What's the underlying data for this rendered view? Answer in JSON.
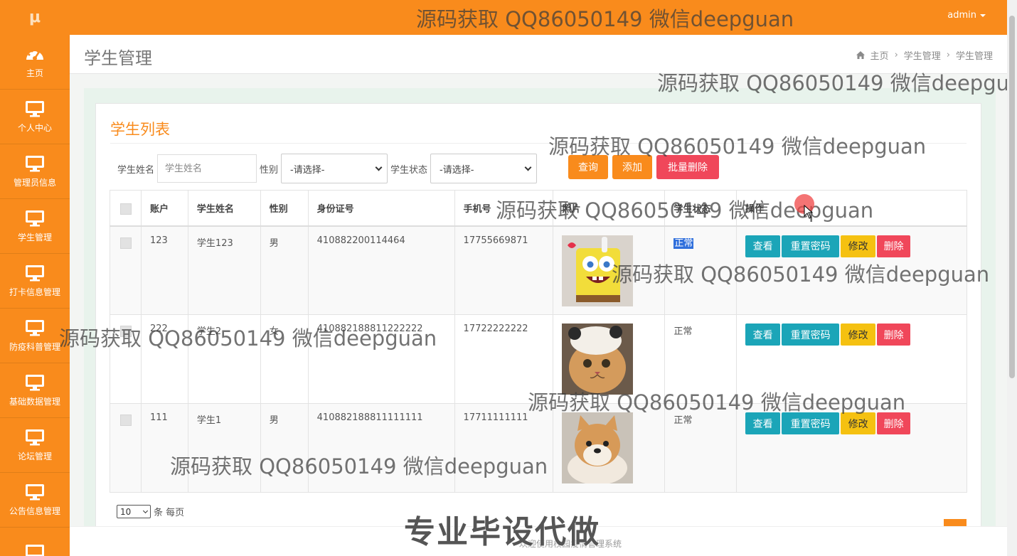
{
  "app": {
    "logo": "μ",
    "admin": "admin"
  },
  "sidebar": {
    "items": [
      {
        "label": "主页",
        "icon": "dashboard-icon"
      },
      {
        "label": "个人中心",
        "icon": "monitor-icon"
      },
      {
        "label": "管理员信息",
        "icon": "monitor-icon"
      },
      {
        "label": "学生管理",
        "icon": "monitor-icon"
      },
      {
        "label": "打卡信息管理",
        "icon": "monitor-icon"
      },
      {
        "label": "防疫科普管理",
        "icon": "monitor-icon"
      },
      {
        "label": "基础数据管理",
        "icon": "monitor-icon"
      },
      {
        "label": "论坛管理",
        "icon": "monitor-icon"
      },
      {
        "label": "公告信息管理",
        "icon": "monitor-icon"
      },
      {
        "label": "",
        "icon": "monitor-icon"
      }
    ]
  },
  "header": {
    "title": "学生管理",
    "breadcrumb": [
      "主页",
      "学生管理",
      "学生管理"
    ]
  },
  "card": {
    "title": "学生列表"
  },
  "filters": {
    "name_label": "学生姓名",
    "name_placeholder": "学生姓名",
    "gender_label": "性别",
    "gender_value": "-请选择-",
    "status_label": "学生状态",
    "status_value": "-请选择-"
  },
  "buttons": {
    "query": "查询",
    "add": "添加",
    "batch_delete": "批量删除"
  },
  "table": {
    "columns": [
      "账户",
      "学生姓名",
      "性别",
      "身份证号",
      "手机号",
      "照片",
      "学生状态",
      "操作"
    ],
    "rows": [
      {
        "account": "123",
        "name": "学生123",
        "gender": "男",
        "id_number": "410882200114464",
        "phone": "17755669871",
        "photo": "spongebob",
        "status": "正常"
      },
      {
        "account": "222",
        "name": "学生2",
        "gender": "女",
        "id_number": "410882188811222222",
        "phone": "17722222222",
        "photo": "cat",
        "status": "正常"
      },
      {
        "account": "111",
        "name": "学生1",
        "gender": "男",
        "id_number": "410882188811111111",
        "phone": "17711111111",
        "photo": "shiba",
        "status": "正常"
      }
    ],
    "actions": {
      "view": "查看",
      "reset": "重置密码",
      "edit": "修改",
      "delete": "删除"
    }
  },
  "pager": {
    "size": "10",
    "suffix": "条 每页"
  },
  "footer": {
    "text": "欢迎使用校园疫情管理系统"
  },
  "overlays": {
    "watermark": "源码获取 QQ86050149 微信deepguan",
    "promo": "专业毕设代做"
  },
  "colors": {
    "accent": "#f98b1c",
    "teal": "#1ba5b8",
    "danger": "#f0475a",
    "warning": "#f5c111"
  }
}
